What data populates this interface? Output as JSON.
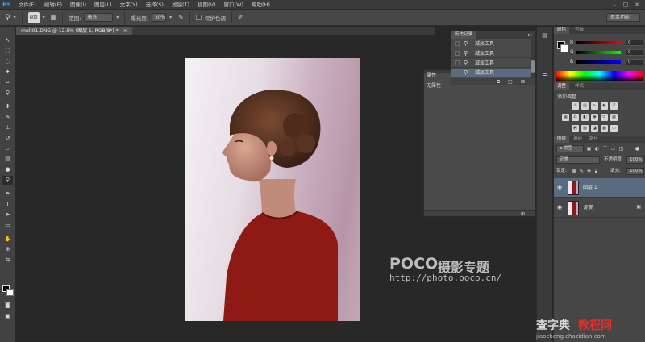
{
  "app": {
    "logo": "Ps",
    "menus": [
      "文件(F)",
      "编辑(E)",
      "图像(I)",
      "图层(L)",
      "文字(Y)",
      "选择(S)",
      "滤镜(T)",
      "视图(V)",
      "窗口(W)",
      "帮助(H)"
    ],
    "window_controls": [
      "–",
      "□",
      "✕"
    ]
  },
  "options_bar": {
    "brush_size": "600",
    "range_label": "范围:",
    "range_value": "高光",
    "exposure_label": "曝光度:",
    "exposure_value": "50%",
    "protect_tones_label": "保护色调",
    "workspace": "基本功能"
  },
  "document": {
    "tab_title": "mult01.DNG @ 12.5% (图层 1, RGB/8*) *",
    "close": "×"
  },
  "watermark": {
    "brand": "POCO",
    "brand_cn": "摄影专题",
    "url": "http://photo.poco.cn/"
  },
  "history_panel": {
    "tab": "历史记录",
    "menu": "▸▸",
    "items": [
      {
        "label": "减淡工具",
        "selected": false
      },
      {
        "label": "减淡工具",
        "selected": false
      },
      {
        "label": "减淡工具",
        "selected": false
      },
      {
        "label": "减淡工具",
        "selected": true
      }
    ]
  },
  "properties_panel": {
    "title": "属性",
    "value": "无属性"
  },
  "color_panel": {
    "tabs": [
      "颜色",
      "色板"
    ],
    "channels": [
      {
        "letter": "R",
        "value": "0",
        "track": "linear-gradient(90deg,#000,#f00)"
      },
      {
        "letter": "G",
        "value": "0",
        "track": "linear-gradient(90deg,#000,#0f0)"
      },
      {
        "letter": "B",
        "value": "0",
        "track": "linear-gradient(90deg,#000,#00f)"
      }
    ]
  },
  "adjustments_panel": {
    "tabs": [
      "调整",
      "样式"
    ],
    "title": "添加调整"
  },
  "layers_panel": {
    "tabs": [
      "图层",
      "通道",
      "路径"
    ],
    "filter_kind": "ρ 类型",
    "blend_mode": "正常",
    "opacity_label": "不透明度:",
    "opacity_value": "100%",
    "lock_label": "锁定:",
    "fill_label": "填充:",
    "fill_value": "100%",
    "layers": [
      {
        "name": "图层 1",
        "selected": true,
        "locked": false
      },
      {
        "name": "背景",
        "selected": false,
        "locked": true
      }
    ]
  },
  "site_watermark": {
    "title": "查字典",
    "title2": "教程网",
    "url": "jiaocheng.chazidian.com"
  }
}
